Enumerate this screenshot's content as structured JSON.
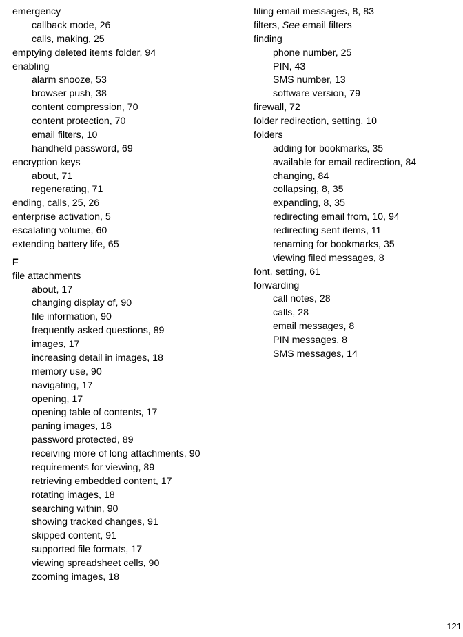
{
  "page_number": "121",
  "left_column": [
    {
      "level": 0,
      "text": "emergency"
    },
    {
      "level": 1,
      "text": "callback mode, 26"
    },
    {
      "level": 1,
      "text": "calls, making, 25"
    },
    {
      "level": 0,
      "text": "emptying deleted items folder, 94"
    },
    {
      "level": 0,
      "text": "enabling"
    },
    {
      "level": 1,
      "text": "alarm snooze, 53"
    },
    {
      "level": 1,
      "text": "browser push, 38"
    },
    {
      "level": 1,
      "text": "content compression, 70"
    },
    {
      "level": 1,
      "text": "content protection, 70"
    },
    {
      "level": 1,
      "text": "email filters, 10"
    },
    {
      "level": 1,
      "text": "handheld password, 69"
    },
    {
      "level": 0,
      "text": "encryption keys"
    },
    {
      "level": 1,
      "text": "about, 71"
    },
    {
      "level": 1,
      "text": "regenerating, 71"
    },
    {
      "level": 0,
      "text": "ending, calls, 25, 26"
    },
    {
      "level": 0,
      "text": "enterprise activation, 5"
    },
    {
      "level": 0,
      "text": "escalating volume, 60"
    },
    {
      "level": 0,
      "text": "extending battery life, 65"
    },
    {
      "level": 0,
      "letter": true,
      "text": "F"
    },
    {
      "level": 0,
      "text": "file attachments"
    },
    {
      "level": 1,
      "text": "about, 17"
    },
    {
      "level": 1,
      "text": "changing display of, 90"
    },
    {
      "level": 1,
      "text": "file information, 90"
    },
    {
      "level": 1,
      "text": "frequently asked questions, 89"
    },
    {
      "level": 1,
      "text": "images, 17"
    },
    {
      "level": 1,
      "text": "increasing detail in images, 18"
    },
    {
      "level": 1,
      "text": "memory use, 90"
    },
    {
      "level": 1,
      "text": "navigating, 17"
    },
    {
      "level": 1,
      "text": "opening, 17"
    },
    {
      "level": 1,
      "text": "opening table of contents, 17"
    },
    {
      "level": 1,
      "text": "paning images, 18"
    },
    {
      "level": 1,
      "text": "password protected, 89"
    },
    {
      "level": 1,
      "text": "receiving more of long attachments, 90"
    },
    {
      "level": 1,
      "text": "requirements for viewing, 89"
    },
    {
      "level": 1,
      "text": "retrieving embedded content, 17"
    },
    {
      "level": 1,
      "text": "rotating images, 18"
    },
    {
      "level": 1,
      "text": "searching within, 90"
    },
    {
      "level": 1,
      "text": "showing tracked changes, 91"
    },
    {
      "level": 1,
      "text": "skipped content, 91"
    },
    {
      "level": 1,
      "text": "supported file formats, 17"
    },
    {
      "level": 1,
      "text": "viewing spreadsheet cells, 90"
    },
    {
      "level": 1,
      "text": "zooming images, 18"
    }
  ],
  "right_column": [
    {
      "level": 0,
      "text": "filing email messages, 8, 83"
    },
    {
      "level": 0,
      "see_entry": true,
      "prefix": "filters, ",
      "see_word": "See",
      "target": " email filters"
    },
    {
      "level": 0,
      "text": "finding"
    },
    {
      "level": 1,
      "text": "phone number, 25"
    },
    {
      "level": 1,
      "text": "PIN, 43"
    },
    {
      "level": 1,
      "text": "SMS number, 13"
    },
    {
      "level": 1,
      "text": "software version, 79"
    },
    {
      "level": 0,
      "text": "firewall, 72"
    },
    {
      "level": 0,
      "text": "folder redirection, setting, 10"
    },
    {
      "level": 0,
      "text": "folders"
    },
    {
      "level": 1,
      "text": "adding for bookmarks, 35"
    },
    {
      "level": 1,
      "text": "available for email redirection, 84"
    },
    {
      "level": 1,
      "text": "changing, 84"
    },
    {
      "level": 1,
      "text": "collapsing, 8, 35"
    },
    {
      "level": 1,
      "text": "expanding, 8, 35"
    },
    {
      "level": 1,
      "text": "redirecting email from, 10, 94"
    },
    {
      "level": 1,
      "text": "redirecting sent items, 11"
    },
    {
      "level": 1,
      "text": "renaming for bookmarks, 35"
    },
    {
      "level": 1,
      "text": "viewing filed messages, 8"
    },
    {
      "level": 0,
      "text": "font, setting, 61"
    },
    {
      "level": 0,
      "text": "forwarding"
    },
    {
      "level": 1,
      "text": "call notes, 28"
    },
    {
      "level": 1,
      "text": "calls, 28"
    },
    {
      "level": 1,
      "text": "email messages, 8"
    },
    {
      "level": 1,
      "text": "PIN messages, 8"
    },
    {
      "level": 1,
      "text": "SMS messages, 14"
    }
  ]
}
